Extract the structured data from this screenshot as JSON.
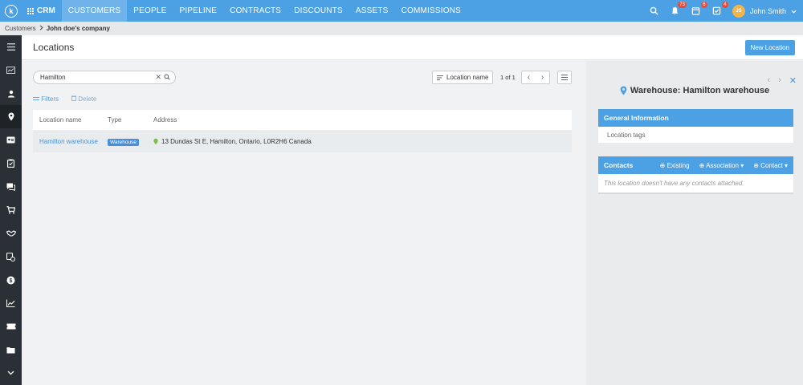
{
  "app": {
    "logo_letter": "k",
    "name": "CRM"
  },
  "nav": {
    "items": [
      {
        "label": "CUSTOMERS",
        "active": true
      },
      {
        "label": "PEOPLE"
      },
      {
        "label": "PIPELINE"
      },
      {
        "label": "CONTRACTS"
      },
      {
        "label": "DISCOUNTS"
      },
      {
        "label": "ASSETS"
      },
      {
        "label": "COMMISSIONS"
      }
    ]
  },
  "topright": {
    "notifications_count": "73",
    "tasks_count": "6",
    "approvals_count": "4",
    "user_initials": "JS",
    "user_name": "John Smith"
  },
  "breadcrumb": {
    "parent": "Customers",
    "current": "John doe's company"
  },
  "sidebar": {
    "icons": [
      "dashboard-icon",
      "person-icon",
      "location-pin-icon",
      "contact-card-icon",
      "clipboard-icon",
      "chat-icon",
      "cart-icon",
      "handshake-icon",
      "billing-icon",
      "dollar-icon",
      "chart-icon",
      "ticket-icon",
      "folder-icon",
      "chevron-down-icon"
    ],
    "active_index": 2
  },
  "page": {
    "title": "Locations",
    "new_button": "New Location"
  },
  "search": {
    "value": "Hamilton"
  },
  "toolbar": {
    "filters": "Filters",
    "delete": "Delete"
  },
  "sort": {
    "label": "Location name"
  },
  "pager": {
    "text": "1 of 1"
  },
  "table": {
    "headers": {
      "name": "Location name",
      "type": "Type",
      "address": "Address"
    },
    "rows": [
      {
        "name": "Hamilton warehouse",
        "type": "Warehouse",
        "address": "13 Dundas St E, Hamilton, Ontario, L0R2H6 Canada"
      }
    ]
  },
  "detail": {
    "title": "Warehouse: Hamilton warehouse",
    "general_header": "General Information",
    "location_tags_label": "Location tags",
    "contacts_header": "Contacts",
    "existing": "Existing",
    "association": "Association",
    "contact": "Contact",
    "empty_contacts": "This location doesn't have any contacts attached."
  },
  "colors": {
    "brand": "#4ca1e4",
    "sidebar": "#2a3036",
    "badge": "#e84c3d"
  }
}
